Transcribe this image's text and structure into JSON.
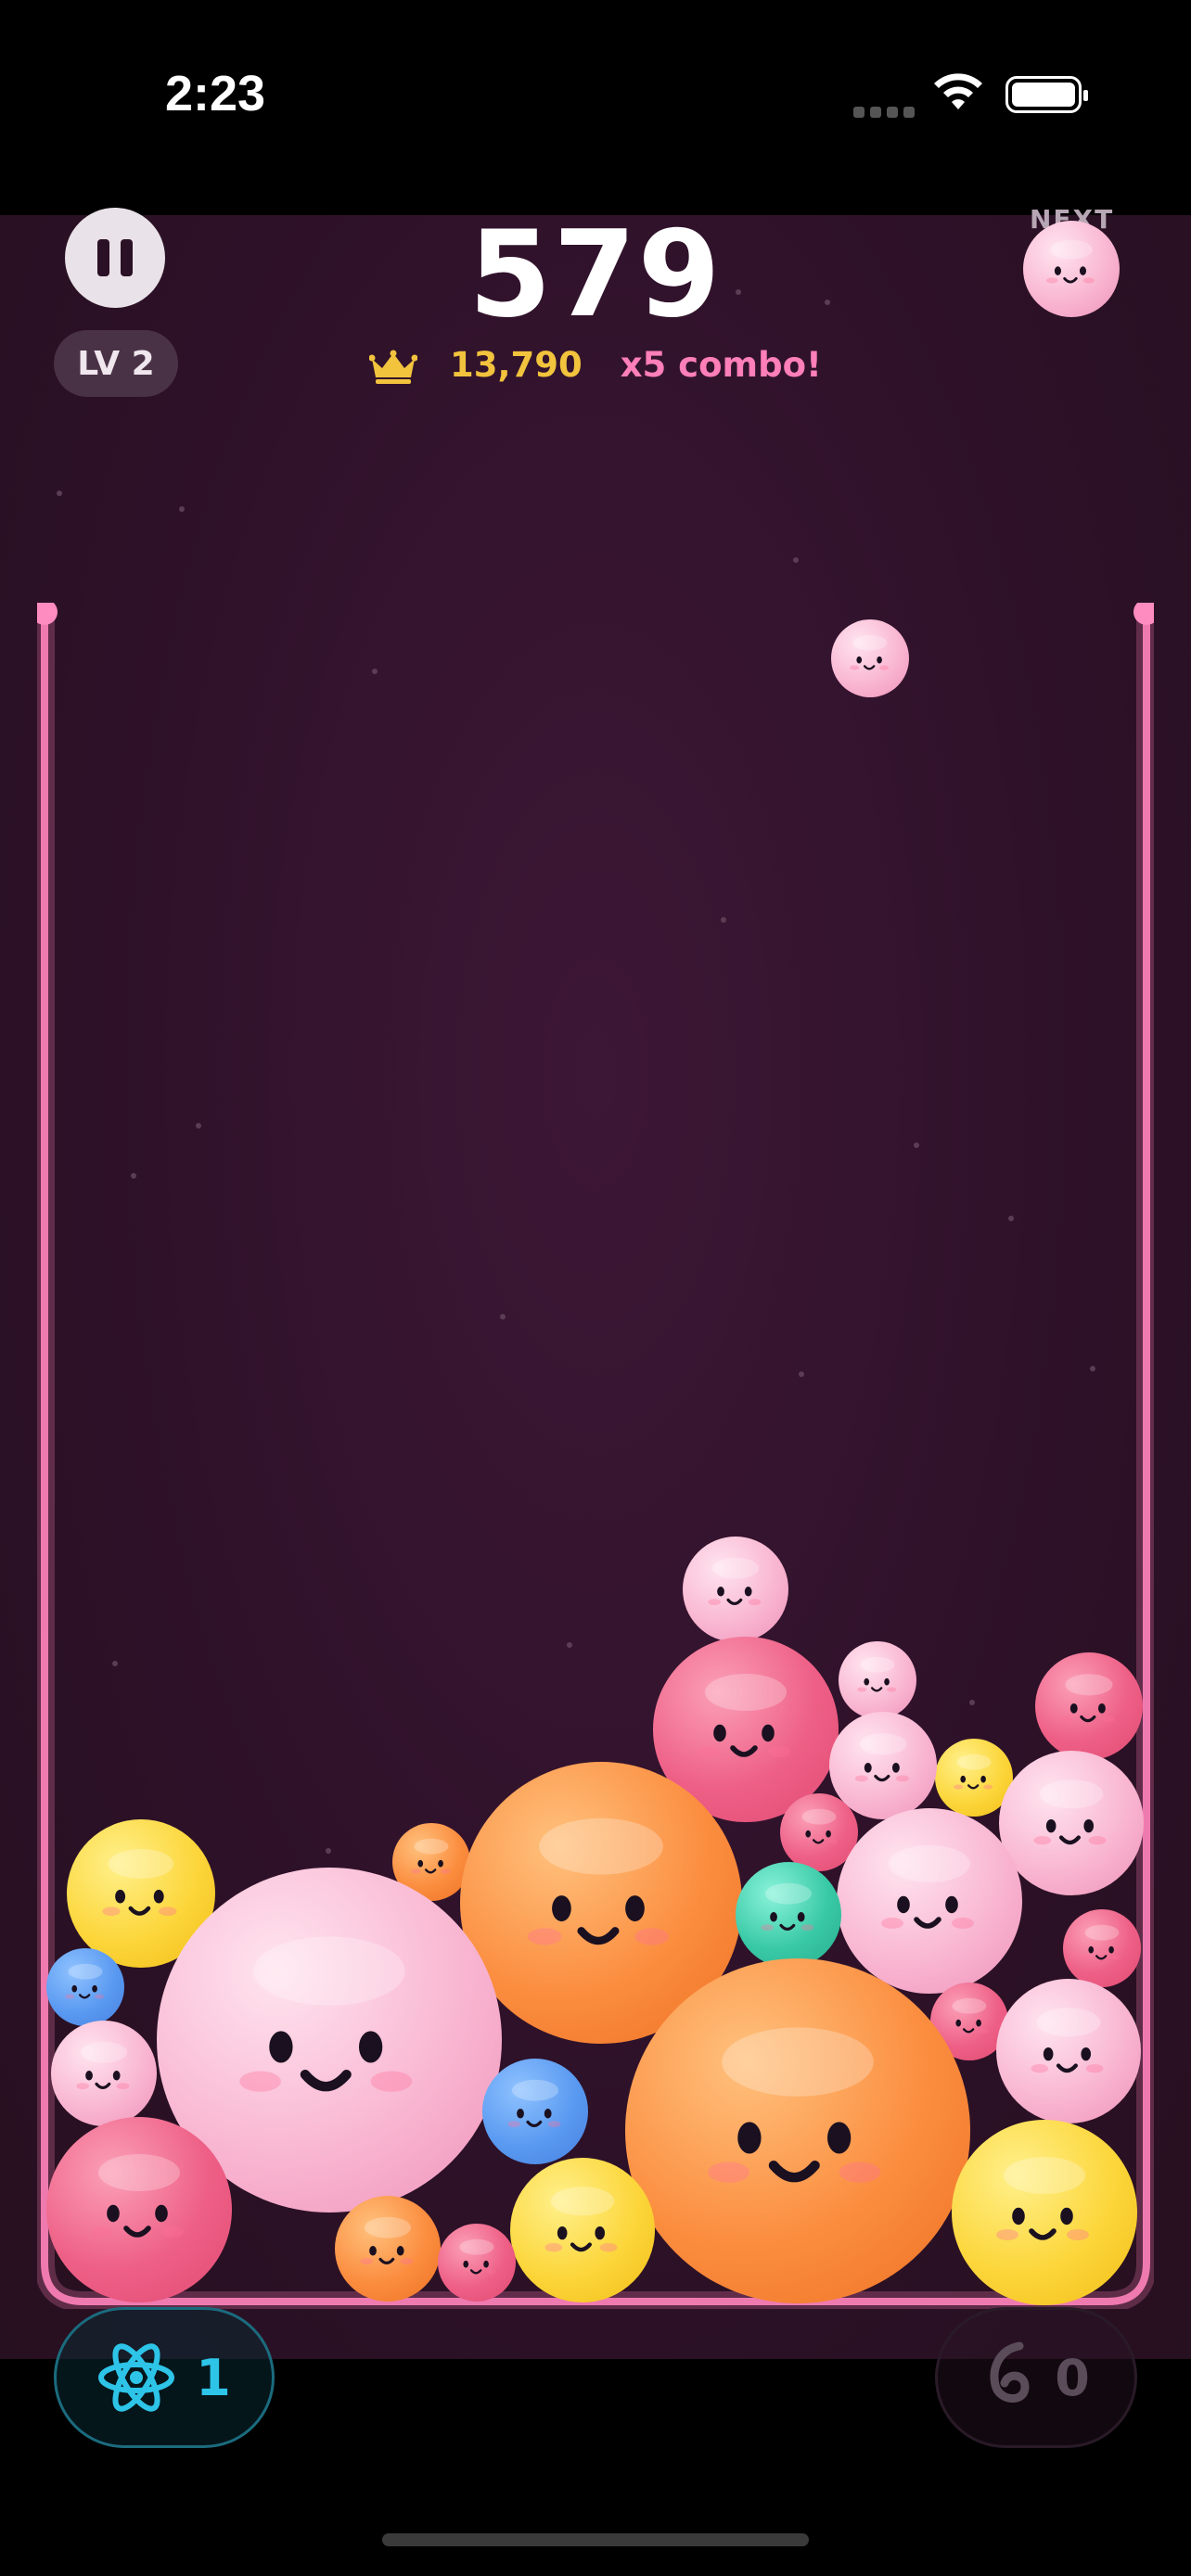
{
  "status_bar": {
    "time": "2:23"
  },
  "hud": {
    "score": "579",
    "best_score": "13,790",
    "combo": "x5 combo!",
    "level": "LV 2",
    "next_label": "NEXT",
    "next_ball": "pink-small"
  },
  "powerups": {
    "atom": {
      "icon": "atom-icon",
      "count": "1",
      "color": "#2dc4e8"
    },
    "shake": {
      "icon": "swirl-icon",
      "count": "0",
      "color": "#5b4c59"
    }
  },
  "colors": {
    "background": "#2d1128",
    "container_border": "#ff7fb8",
    "crown": "#f2c33d",
    "combo": "#ff7fb8"
  },
  "balls": [
    {
      "kind": "pink-small"
    },
    {
      "kind": "pink-small"
    },
    {
      "kind": "pink-medium"
    },
    {
      "kind": "yellow"
    },
    {
      "kind": "pink-small"
    },
    {
      "kind": "pink-medium"
    },
    {
      "kind": "pink-medium"
    },
    {
      "kind": "pink-small"
    },
    {
      "kind": "orange"
    },
    {
      "kind": "pink-small"
    },
    {
      "kind": "yellow"
    },
    {
      "kind": "orange"
    },
    {
      "kind": "teal"
    },
    {
      "kind": "pink-medium"
    },
    {
      "kind": "pink-small"
    },
    {
      "kind": "blue"
    },
    {
      "kind": "pink-small"
    },
    {
      "kind": "pink-medium"
    },
    {
      "kind": "pink-small"
    },
    {
      "kind": "orange"
    },
    {
      "kind": "blue"
    },
    {
      "kind": "pink-medium"
    },
    {
      "kind": "yellow"
    },
    {
      "kind": "yellow"
    },
    {
      "kind": "orange"
    },
    {
      "kind": "pink-medium"
    },
    {
      "kind": "pink-small"
    },
    {
      "kind": "orange"
    }
  ]
}
